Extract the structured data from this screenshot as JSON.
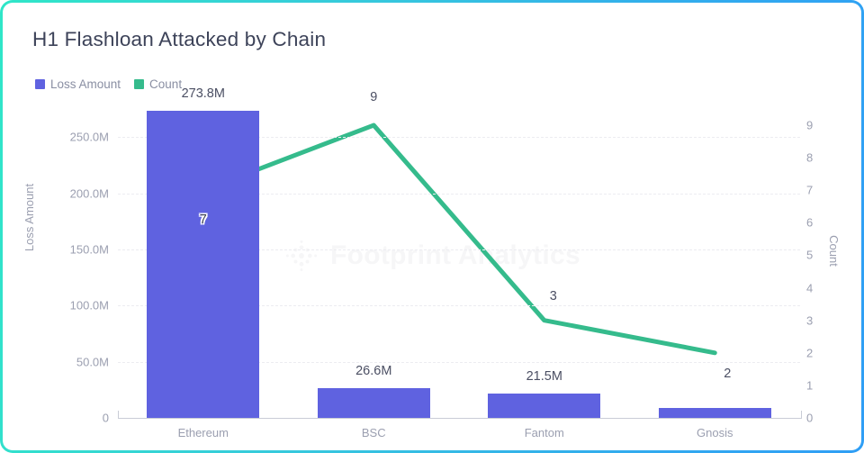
{
  "card": {
    "border_gradient_from": "#2fe6c8",
    "border_gradient_to": "#2f9ef5",
    "background": "#ffffff"
  },
  "header": {
    "title": "H1 Flashloan Attacked by Chain"
  },
  "legend": {
    "position": "top-left",
    "items": [
      {
        "label": "Loss Amount",
        "color": "#5f62e0",
        "swatch_icon": "square-swatch-icon"
      },
      {
        "label": "Count",
        "color": "#35bb8c",
        "swatch_icon": "square-swatch-icon"
      }
    ]
  },
  "watermark": {
    "text": "Footprint Analytics",
    "logo_icon": "footprint-burst-logo-icon",
    "color": "#f0f0f2"
  },
  "chart_data": {
    "type": "bar",
    "title": "H1 Flashloan Attacked by Chain",
    "xlabel": "",
    "categories": [
      "Ethereum",
      "BSC",
      "Fantom",
      "Gnosis"
    ],
    "grid": true,
    "grid_style": "dashed",
    "grid_color": "#ececf1",
    "series": [
      {
        "name": "Loss Amount",
        "type": "bar",
        "axis": "left",
        "color": "#5f62e0",
        "values": [
          273800000,
          26600000,
          21500000,
          9000000
        ],
        "labels": [
          "273.8M",
          "26.6M",
          "21.5M",
          ""
        ]
      },
      {
        "name": "Count",
        "type": "line",
        "axis": "right",
        "color": "#35bb8c",
        "values": [
          7,
          9,
          3,
          2
        ],
        "labels": [
          "7",
          "9",
          "3",
          "2"
        ]
      }
    ],
    "yaxis_left": {
      "label": "Loss Amount",
      "ylim": [
        0,
        275000000
      ],
      "ticks": [
        0,
        50000000,
        100000000,
        150000000,
        200000000,
        250000000
      ],
      "tick_labels": [
        "0",
        "50.0M",
        "100.0M",
        "150.0M",
        "200.0M",
        "250.0M"
      ]
    },
    "yaxis_right": {
      "label": "Count",
      "ylim": [
        0,
        9.5
      ],
      "ticks": [
        0,
        1,
        2,
        3,
        4,
        5,
        6,
        7,
        8,
        9
      ],
      "tick_labels": [
        "0",
        "1",
        "2",
        "3",
        "4",
        "5",
        "6",
        "7",
        "8",
        "9"
      ]
    }
  }
}
